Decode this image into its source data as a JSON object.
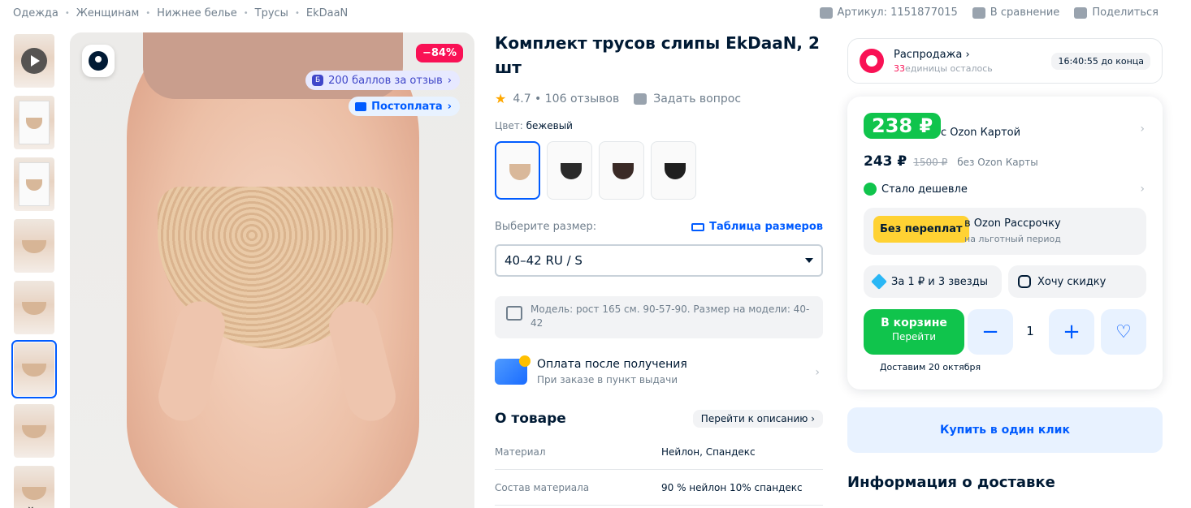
{
  "breadcrumbs": [
    "Одежда",
    "Женщинам",
    "Нижнее белье",
    "Трусы",
    "EkDaaN"
  ],
  "top_actions": {
    "article": "Артикул: 1151877015",
    "compare": "В сравнение",
    "share": "Поделиться"
  },
  "gallery": {
    "discount_badge": "−84%",
    "points_badge": "200 баллов за отзыв",
    "points_icon_letter": "Б",
    "postpay_badge": "Постоплата",
    "thumb_count": 8,
    "active_thumb_index": 5
  },
  "product": {
    "title": "Комплект трусов слипы EkDaaN, 2 шт",
    "rating": "4.7 • 106 отзывов",
    "ask_question": "Задать вопрос",
    "color_label": "Цвет:",
    "color_value": "бежевый",
    "swatch_colors": [
      "#d9b89a",
      "#2b2b2b",
      "#3a2a26",
      "#1f1f1f"
    ],
    "size_label": "Выберите размер:",
    "size_table_link": "Таблица размеров",
    "selected_size": "40–42 RU / S",
    "model_info": "Модель: рост 165 см. 90-57-90. Размер на модели: 40-42",
    "payment_title": "Оплата после получения",
    "payment_subtitle": "При заказе в пункт выдачи",
    "about_title": "О товаре",
    "about_link": "Перейти к описанию",
    "specs": [
      {
        "key": "Материал",
        "value": "Нейлон, Спандекс"
      },
      {
        "key": "Состав материала",
        "value": "90 % нейлон 10% спандекс"
      }
    ]
  },
  "sale": {
    "title": "Распродажа",
    "remaining_num": "33",
    "remaining_text": "единицы осталось",
    "timer": "16:40:55 до конца"
  },
  "pricing": {
    "card_price": "238 ₽",
    "card_price_label": "с Ozon Картой",
    "regular_price": "243 ₽",
    "old_price": "1500 ₽",
    "regular_label": "без Ozon Карты",
    "cheaper": "Стало дешевле",
    "installment_badge": "Без переплат",
    "installment_title": "в Ozon Рассрочку",
    "installment_sub": "на льготный период",
    "stars_offer": "За 1 ₽ и 3 звезды",
    "want_discount": "Хочу скидку",
    "cart_line1": "В корзине",
    "cart_line2": "Перейти",
    "quantity": "1",
    "delivery_date": "Доставим 20 октября",
    "buy_one_click": "Купить в один клик",
    "delivery_info": "Информация о доставке"
  },
  "colors": {
    "accent_blue": "#005bff",
    "sale_pink": "#f91155",
    "price_green": "#10c44c",
    "installment_yellow": "#ffd233"
  }
}
